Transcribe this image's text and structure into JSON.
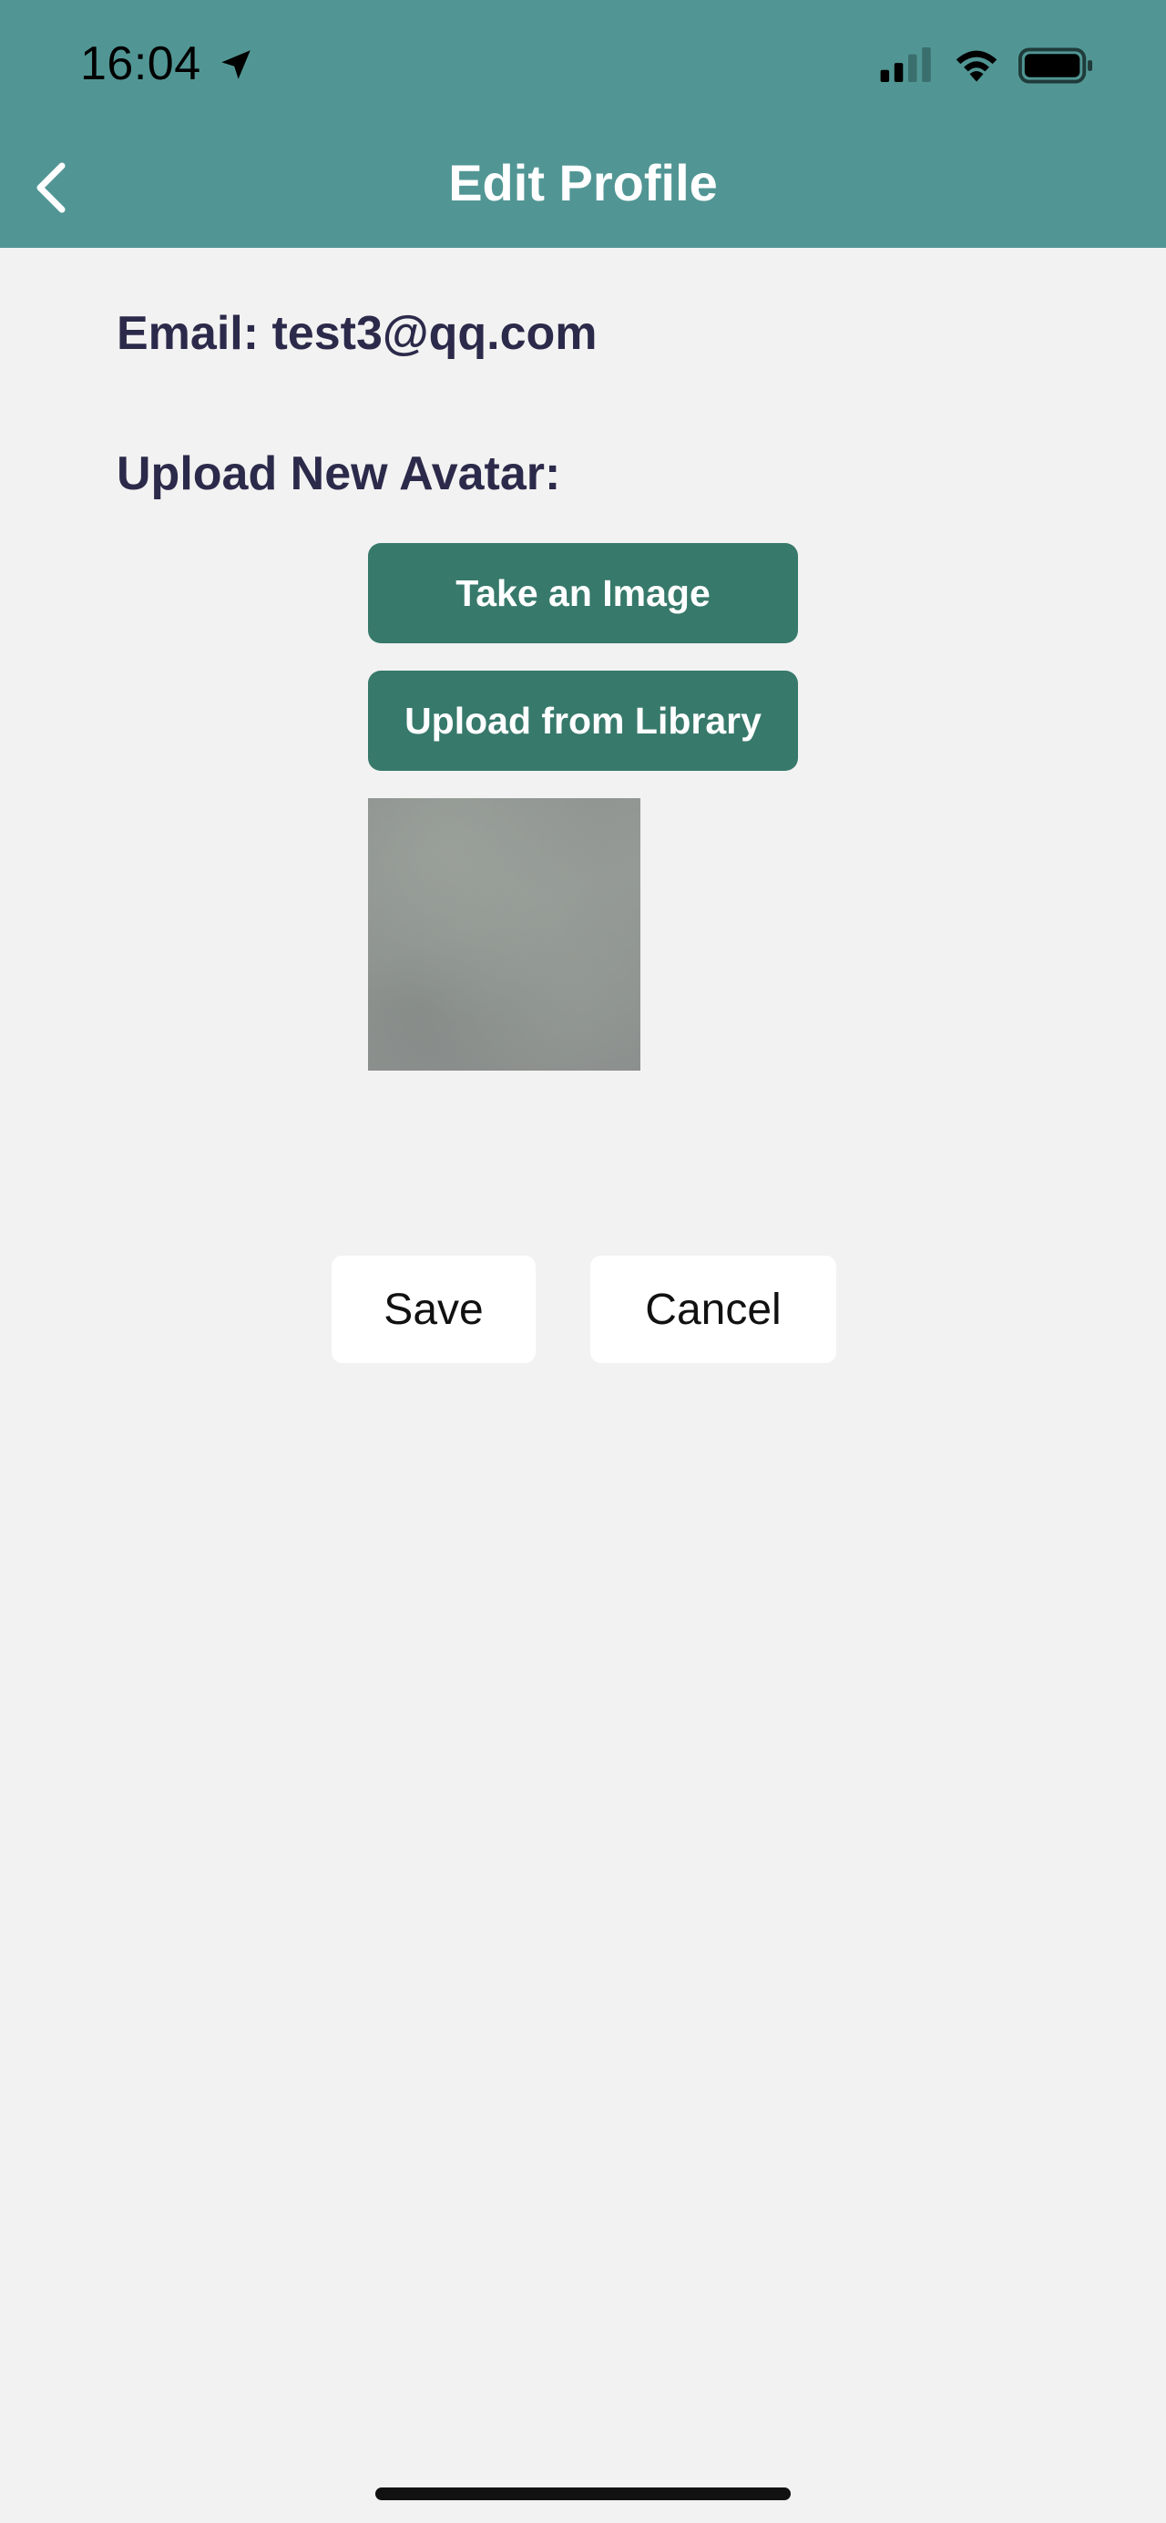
{
  "status_bar": {
    "time": "16:04",
    "icons": [
      "location-arrow-icon",
      "cellular-signal-icon",
      "wifi-icon",
      "battery-icon"
    ]
  },
  "header": {
    "title": "Edit Profile",
    "back_icon": "chevron-left-icon",
    "background_color": "#519694"
  },
  "profile": {
    "email_text": "Email: test3@qq.com",
    "upload_label": "Upload New Avatar:"
  },
  "avatar_actions": {
    "take_image_label": "Take an Image",
    "upload_library_label": "Upload from Library",
    "button_color": "#37796b"
  },
  "footer_actions": {
    "save_label": "Save",
    "cancel_label": "Cancel"
  }
}
